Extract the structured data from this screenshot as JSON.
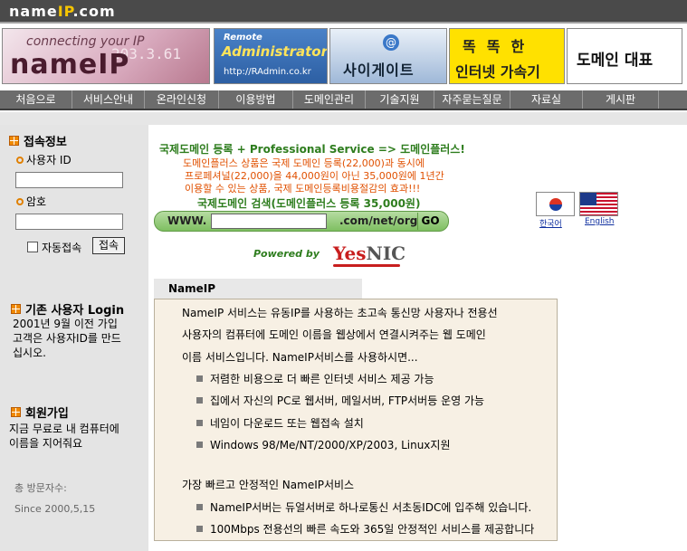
{
  "header": {
    "logo_name": "name",
    "logo_ip": "IP",
    "logo_tld": ".com"
  },
  "banners": {
    "connect": {
      "line1": "connecting your IP",
      "line2": "nameIP",
      "line3": "203.3.61"
    },
    "radmin": {
      "line1": "Remote",
      "line2": "Administrator",
      "line3": "http://RAdmin.co.kr"
    },
    "sigate": {
      "at": "@",
      "label": "사이게이트"
    },
    "accel": {
      "line1": "똑똑한",
      "line2": "인터넷 가속기"
    },
    "domain": {
      "label": "도메인 대표"
    }
  },
  "nav": {
    "items": [
      "처음으로",
      "서비스안내",
      "온라인신청",
      "이용방법",
      "도메인관리",
      "기술지원",
      "자주묻는질문",
      "자료실",
      "게시판"
    ]
  },
  "sidebar": {
    "login_title": "접속정보",
    "user_id_label": "사용자 ID",
    "password_label": "암호",
    "auto_login_label": "자동접속",
    "login_button": "접속",
    "existing_title": "기존 사용자 Login",
    "existing_text": [
      "2001년 9월 이전 가입",
      "고객은 사용자ID를 만드",
      "십시오."
    ],
    "join_title": "회원가입",
    "join_text": [
      "지금 무료로 내 컴퓨터에",
      "이름을 지어줘요"
    ],
    "visitors_label": "총 방문자수:",
    "since": "Since 2000,5,15"
  },
  "promo": {
    "headline": "국제도메인 등록 + Professional Service => 도메인플러스!",
    "lines": [
      "도메인플러스 상품은 국제 도메인 등록(22,000)과 동시에",
      "프로페셔널(22,000)을 44,000원이 아닌 35,000원에 1년간",
      "이용할 수 있는 상품, 국제 도메인등록비용절감의 효과!!!"
    ],
    "search_title": "국제도메인 검색(도메인플러스 등록 35,000원)",
    "search_prefix": "WWW.",
    "search_suffix": ".com/net/org",
    "search_go": "GO",
    "powered_by": "Powered by",
    "yesnic_y": "Yes",
    "yesnic_rest": "NIC"
  },
  "languages": {
    "korean": "한국어",
    "english": "English"
  },
  "info": {
    "tab_title": "NameIP",
    "intro": [
      "NameIP 서비스는 유동IP를 사용하는 초고속 통신망 사용자나 전용선",
      "사용자의 컴퓨터에 도메인 이름을 웹상에서 연결시켜주는 웹 도메인",
      "이름 서비스입니다. NameIP서비스를 사용하시면..."
    ],
    "benefits": [
      "저렴한 비용으로 더 빠른 인터넷 서비스 제공 가능",
      "집에서 자신의 PC로 웹서버, 메일서버, FTP서버등 운영 가능",
      "네임이 다운로드 또는 웹접속 설치",
      "Windows 98/Me/NT/2000/XP/2003, Linux지원"
    ],
    "stable_title": "가장 빠르고 안정적인 NameIP서비스",
    "stable_items": [
      "NameIP서버는 듀얼서버로 하나로통신 서초동IDC에 입주해 있습니다.",
      "100Mbps 전용선의 빠른 속도와 365일 안정적인 서비스를 제공합니다"
    ]
  }
}
